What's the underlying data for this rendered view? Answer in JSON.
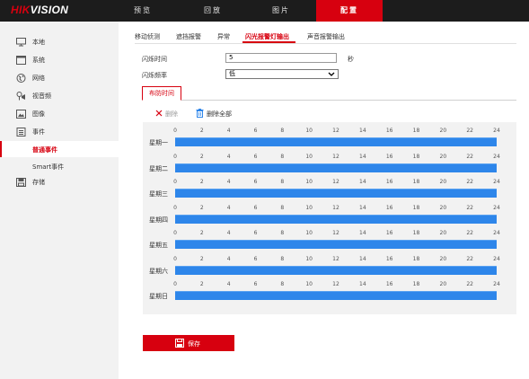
{
  "brand": {
    "logo_text": "HIKVISION",
    "logo_red": "HIK",
    "logo_white": "VISION"
  },
  "nav": {
    "tabs": [
      {
        "label": "预览",
        "active": false
      },
      {
        "label": "回放",
        "active": false
      },
      {
        "label": "图片",
        "active": false
      },
      {
        "label": "配置",
        "active": true
      }
    ]
  },
  "sidebar": {
    "items": [
      {
        "label": "本地",
        "icon": "monitor-icon"
      },
      {
        "label": "系统",
        "icon": "system-icon"
      },
      {
        "label": "网络",
        "icon": "globe-icon"
      },
      {
        "label": "视音频",
        "icon": "video-audio-icon"
      },
      {
        "label": "图像",
        "icon": "image-icon"
      },
      {
        "label": "事件",
        "icon": "event-icon"
      }
    ],
    "event_subitems": [
      {
        "label": "普通事件",
        "active": true
      },
      {
        "label": "Smart事件",
        "active": false
      }
    ],
    "storage": {
      "label": "存储",
      "icon": "storage-icon"
    }
  },
  "subtabs": [
    {
      "label": "移动侦测",
      "active": false
    },
    {
      "label": "遮挡报警",
      "active": false
    },
    {
      "label": "异常",
      "active": false
    },
    {
      "label": "闪光报警灯输出",
      "active": true
    },
    {
      "label": "声音报警输出",
      "active": false
    }
  ],
  "form": {
    "flash_time_label": "闪烁时间",
    "flash_time_value": "5",
    "flash_time_unit": "秒",
    "flash_freq_label": "闪烁频率",
    "flash_freq_value": "低"
  },
  "schedule": {
    "tab_label": "布防时间",
    "delete_label": "删除",
    "delete_all_label": "删除全部",
    "hours": [
      "0",
      "2",
      "4",
      "6",
      "8",
      "10",
      "12",
      "14",
      "16",
      "18",
      "20",
      "22",
      "24"
    ],
    "days": [
      {
        "label": "星期一",
        "start": 0,
        "end": 24
      },
      {
        "label": "星期二",
        "start": 0,
        "end": 24
      },
      {
        "label": "星期三",
        "start": 0,
        "end": 24
      },
      {
        "label": "星期四",
        "start": 0,
        "end": 24
      },
      {
        "label": "星期五",
        "start": 0,
        "end": 24
      },
      {
        "label": "星期六",
        "start": 0,
        "end": 24
      },
      {
        "label": "星期日",
        "start": 0,
        "end": 24
      }
    ]
  },
  "save_label": "保存",
  "colors": {
    "accent": "#d7000f",
    "topbar": "#1c1c1c",
    "schedule_bar": "#2e86ea",
    "sidebar_bg": "#f2f2f2"
  }
}
